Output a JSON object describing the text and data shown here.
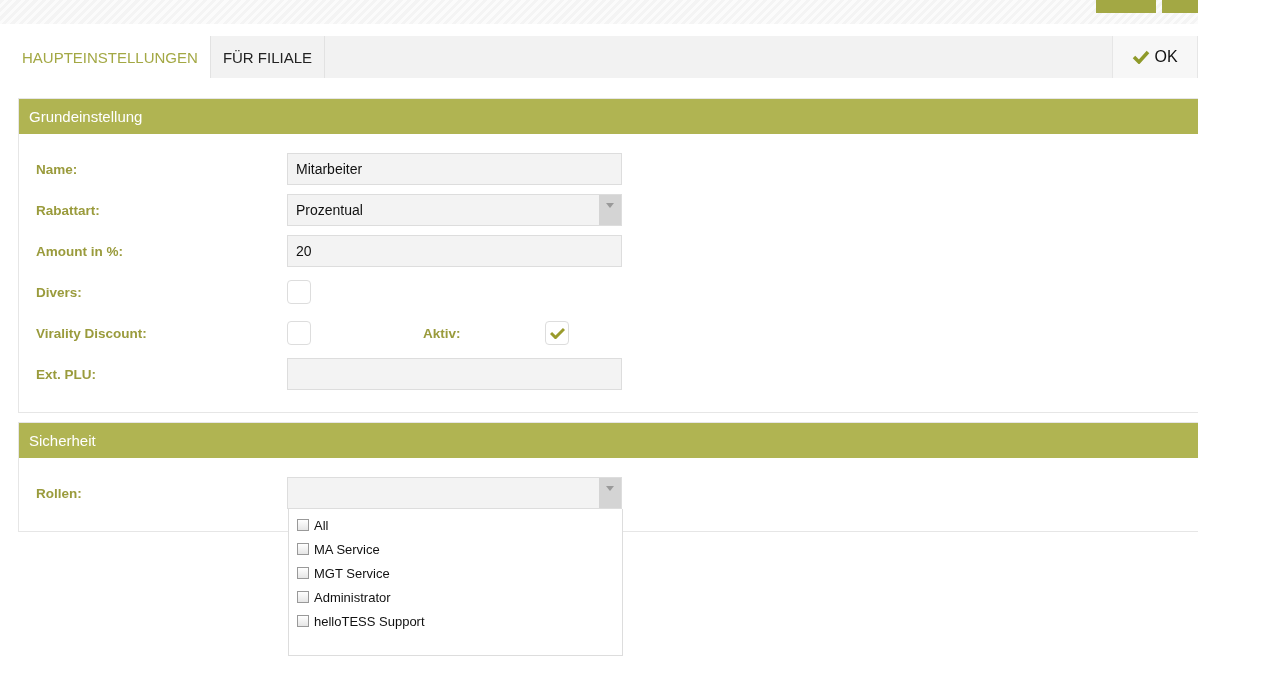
{
  "tabs": [
    {
      "label": "HAUPTEINSTELLUNGEN",
      "selected": true
    },
    {
      "label": "FÜR FILIALE",
      "selected": false
    }
  ],
  "ok_button": {
    "label": "OK"
  },
  "sections": [
    {
      "title": "Grundeinstellung",
      "fields": [
        {
          "kind": "text",
          "label": "Name:",
          "value": "Mitarbeiter"
        },
        {
          "kind": "select",
          "label": "Rabattart:",
          "value": "Prozentual"
        },
        {
          "kind": "text",
          "label": "Amount in %:",
          "value": "20"
        },
        {
          "kind": "checkbox",
          "label": "Divers:",
          "checked": false
        },
        {
          "kind": "checkbox",
          "label": "Virality Discount:",
          "checked": false,
          "extra": {
            "label": "Aktiv:",
            "checked": true
          }
        },
        {
          "kind": "text",
          "label": "Ext. PLU:"
        }
      ]
    },
    {
      "title": "Sicherheit",
      "fields": [
        {
          "kind": "multiselect",
          "label": "Rollen:",
          "options": [
            {
              "label": "All",
              "checked": false
            },
            {
              "label": "MA Service",
              "checked": false
            },
            {
              "label": "MGT Service",
              "checked": false
            },
            {
              "label": "Administrator",
              "checked": false
            },
            {
              "label": "helloTESS Support",
              "checked": false
            }
          ]
        }
      ]
    }
  ]
}
